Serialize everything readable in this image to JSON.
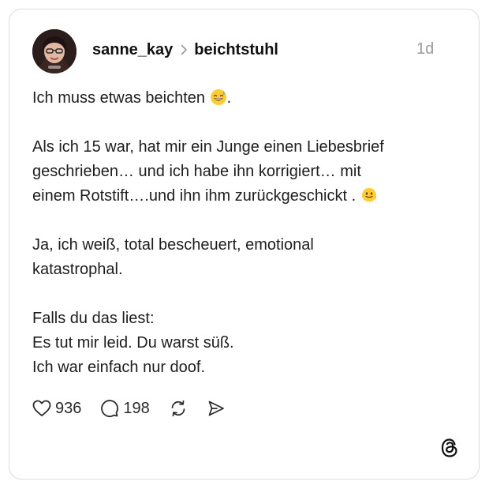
{
  "post": {
    "username": "sanne_kay",
    "community": "beichtstuhl",
    "timestamp": "1d",
    "paragraphs": [
      {
        "lines": [
          "Ich muss etwas beichten"
        ],
        "trailing": ".",
        "emoji": "grinning-sweat-emoji"
      },
      {
        "lines": [
          "Als ich 15 war, hat mir ein Junge einen Liebesbrief",
          "geschrieben… und ich habe ihn korrigiert…  mit",
          "einem Rotstift….und ihn ihm zurückgeschickt ."
        ],
        "emoji": "melting-face-emoji"
      },
      {
        "lines": [
          "Ja, ich weiß, total bescheuert, emotional",
          "katastrophal."
        ]
      },
      {
        "lines": [
          "Falls du das liest:",
          "Es tut mir leid. Du warst süß.",
          "Ich war einfach nur doof."
        ]
      }
    ]
  },
  "actions": {
    "likes": "936",
    "replies": "198",
    "like_icon": "heart-icon",
    "reply_icon": "comment-icon",
    "repost_icon": "repost-icon",
    "share_icon": "send-icon"
  },
  "brand": {
    "logo_icon": "threads-logo-icon"
  },
  "colors": {
    "text": "#1d1d1d",
    "muted": "#9b9b9b",
    "border": "#dcdcdc"
  }
}
